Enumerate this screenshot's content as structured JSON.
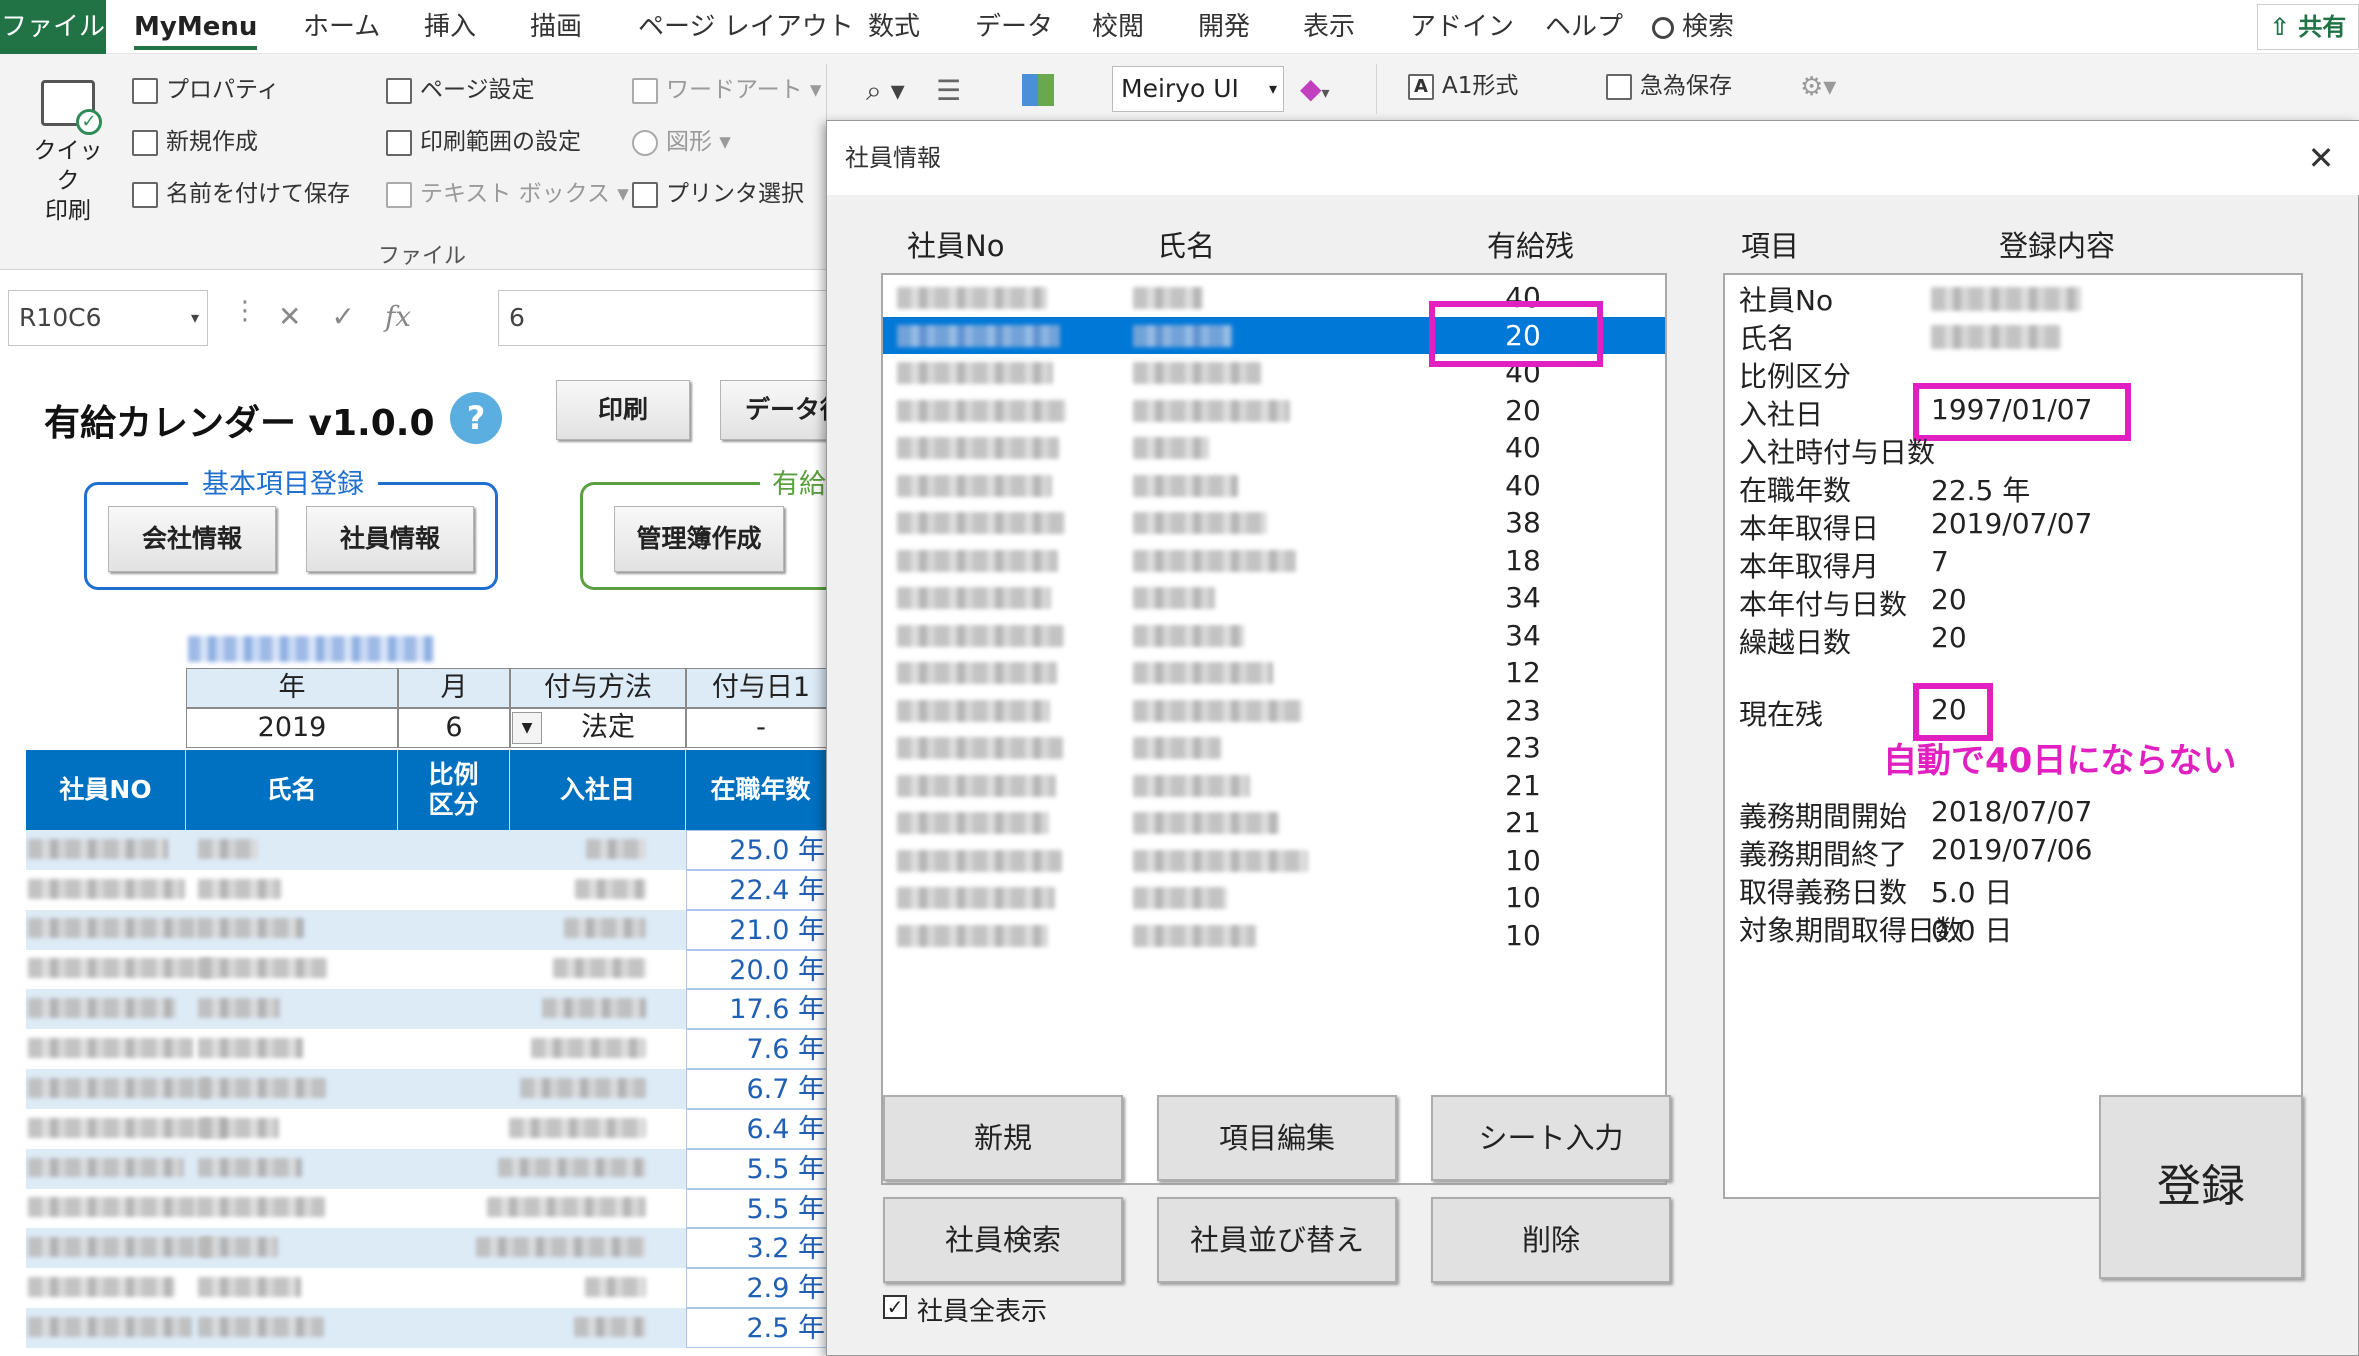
{
  "menubar": {
    "tabs": [
      "ファイル",
      "MyMenu",
      "ホーム",
      "挿入",
      "描画",
      "ページ レイアウト",
      "数式",
      "データ",
      "校閲",
      "開発",
      "表示",
      "アドイン",
      "ヘルプ"
    ],
    "search": "検索",
    "share": "共有"
  },
  "ribbon": {
    "quick_print": [
      "クイック",
      "印刷"
    ],
    "col1": [
      "プロパティ",
      "新規作成",
      "名前を付けて保存"
    ],
    "col2": [
      "ページ設定",
      "印刷範囲の設定",
      "テキスト ボックス"
    ],
    "col3": [
      "ワードアート",
      "図形",
      "プリンタ選択"
    ],
    "group_label": "ファイル",
    "font_name": "Meiryo UI",
    "a1": "A1形式",
    "quick_save": "急為保存"
  },
  "formula_bar": {
    "name_box": "R10C6",
    "fx": "fx",
    "value": "6"
  },
  "sheet": {
    "title": "有給カレンダー v1.0.0",
    "help": "?",
    "print_btn": "印刷",
    "data_btn": "データ復",
    "group1_label": "基本項目登録",
    "company_btn": "会社情報",
    "employee_btn": "社員情報",
    "group2_label": "有給",
    "ledger_btn": "管理簿作成",
    "param_headers": [
      "年",
      "月",
      "付与方法",
      "付与日1"
    ],
    "param_values": [
      "2019",
      "6",
      "法定",
      "-"
    ],
    "table_headers": [
      "社員NO",
      "氏名",
      "比例区分",
      "入社日",
      "在職年数"
    ],
    "years": [
      "25.0 年",
      "22.4 年",
      "21.0 年",
      "20.0 年",
      "17.6 年",
      "7.6 年",
      "6.7 年",
      "6.4 年",
      "5.5 年",
      "5.5 年",
      "3.2 年",
      "2.9 年",
      "2.5 年"
    ]
  },
  "dialog": {
    "title": "社員情報",
    "close": "✕",
    "list_headers": [
      "社員No",
      "氏名",
      "有給残"
    ],
    "leave_balances": [
      "40",
      "20",
      "40",
      "20",
      "40",
      "40",
      "38",
      "18",
      "34",
      "34",
      "12",
      "23",
      "23",
      "21",
      "21",
      "10",
      "10",
      "10"
    ],
    "selected_index": 1,
    "detail_headers": [
      "項目",
      "登録内容"
    ],
    "details": [
      {
        "label": "社員No",
        "value": ""
      },
      {
        "label": "氏名",
        "value": ""
      },
      {
        "label": "比例区分",
        "value": ""
      },
      {
        "label": "入社日",
        "value": "1997/01/07"
      },
      {
        "label": "入社時付与日数",
        "value": ""
      },
      {
        "label": "在職年数",
        "value": "22.5 年"
      },
      {
        "label": "本年取得日",
        "value": "2019/07/07"
      },
      {
        "label": "本年取得月",
        "value": "7"
      },
      {
        "label": "本年付与日数",
        "value": "20"
      },
      {
        "label": "繰越日数",
        "value": "20"
      }
    ],
    "current_label": "現在残",
    "current_value": "20",
    "annotation": "自動で40日にならない",
    "details2": [
      {
        "label": "義務期間開始",
        "value": "2018/07/07"
      },
      {
        "label": "義務期間終了",
        "value": "2019/07/06"
      },
      {
        "label": "取得義務日数",
        "value": "5.0 日"
      },
      {
        "label": "対象期間取得日数",
        "value": "0.0 日"
      }
    ],
    "buttons": [
      "新規",
      "項目編集",
      "シート入力",
      "社員検索",
      "社員並び替え",
      "削除"
    ],
    "register": "登録",
    "show_all": "社員全表示",
    "show_all_checked": "✓"
  },
  "colors": {
    "excel_green": "#217346",
    "header_blue": "#0070c0",
    "highlight": "#e020c0",
    "select": "#0078d7"
  }
}
